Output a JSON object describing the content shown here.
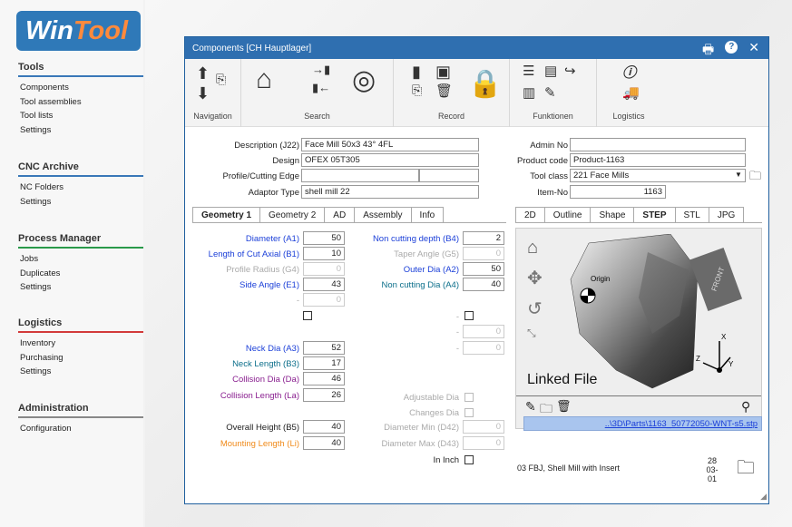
{
  "logo": {
    "part1": "Win",
    "part2": "Tool"
  },
  "sidebar": {
    "tools": {
      "title": "Tools",
      "color": "#3a78b8",
      "items": [
        "Components",
        "Tool assemblies",
        "Tool lists",
        "Settings"
      ]
    },
    "cnc": {
      "title": "CNC Archive",
      "color": "#3a78b8",
      "items": [
        "NC Folders",
        "Settings"
      ]
    },
    "process": {
      "title": "Process Manager",
      "color": "#2a9a4a",
      "items": [
        "Jobs",
        "Duplicates",
        "Settings"
      ]
    },
    "logistics": {
      "title": "Logistics",
      "color": "#d23a3a",
      "items": [
        "Inventory",
        "Purchasing",
        "Settings"
      ]
    },
    "admin": {
      "title": "Administration",
      "color": "#888888",
      "items": [
        "Configuration"
      ]
    }
  },
  "window": {
    "title": "Components  [CH Hauptlager]",
    "ribbon": {
      "navigation": "Navigation",
      "search": "Search",
      "record": "Record",
      "funktionen": "Funktionen",
      "logistics": "Logistics"
    }
  },
  "form": {
    "description_label": "Description (J22)",
    "description_value": "Face Mill 50x3 43° 4FL",
    "design_label": "Design",
    "design_value": "OFEX 05T305",
    "profile_label": "Profile/Cutting Edge",
    "profile_value": "",
    "adaptor_label": "Adaptor Type",
    "adaptor_value": "shell mill 22",
    "admin_no_label": "Admin No",
    "admin_no_value": "",
    "product_code_label": "Product code",
    "product_code_value": "Product-1163",
    "tool_class_label": "Tool class",
    "tool_class_value": "221  Face Mills",
    "item_no_label": "Item-No",
    "item_no_value": "1163"
  },
  "tabs_left": [
    "Geometry 1",
    "Geometry 2",
    "AD",
    "Assembly",
    "Info"
  ],
  "tabs_right": [
    "2D",
    "Outline",
    "Shape",
    "STEP",
    "STL",
    "JPG"
  ],
  "geometry": {
    "diameter_label": "Diameter (A1)",
    "diameter_value": "50",
    "loc_label": "Length of Cut Axial (B1)",
    "loc_value": "10",
    "profile_radius_label": "Profile Radius (G4)",
    "profile_radius_value": "0",
    "side_angle_label": "Side Angle (E1)",
    "side_angle_value": "43",
    "blank1_value": "0",
    "non_cut_depth_label": "Non cutting depth (B4)",
    "non_cut_depth_value": "2",
    "taper_label": "Taper Angle (G5)",
    "taper_value": "0",
    "outer_dia_label": "Outer Dia (A2)",
    "outer_dia_value": "50",
    "non_cut_dia_label": "Non cutting Dia (A4)",
    "non_cut_dia_value": "40",
    "dash": "-",
    "zero": "0",
    "neck_dia_label": "Neck Dia (A3)",
    "neck_dia_value": "52",
    "neck_len_label": "Neck Length (B3)",
    "neck_len_value": "17",
    "coll_dia_label": "Collision Dia (Da)",
    "coll_dia_value": "46",
    "coll_len_label": "Collision Length (La)",
    "coll_len_value": "26",
    "adj_dia_label": "Adjustable Dia",
    "changes_dia_label": "Changes Dia",
    "dia_min_label": "Diameter Min (D42)",
    "dia_min_value": "0",
    "dia_max_label": "Diameter Max (D43)",
    "dia_max_value": "0",
    "overall_label": "Overall Height (B5)",
    "overall_value": "40",
    "mounting_label": "Mounting Length (Li)",
    "mounting_value": "40",
    "in_inch_label": "In Inch"
  },
  "viewer": {
    "linked_file": "Linked File",
    "origin": "Origin",
    "front": "FRONT",
    "axis_x": "X",
    "axis_y": "Y",
    "axis_z": "Z",
    "path": "..\\3D\\Parts\\1163_50772050-WNT-s5.stp"
  },
  "footer": {
    "description": "03 FBJ, Shell Mill with Insert",
    "count": "28",
    "code": "03-01"
  }
}
